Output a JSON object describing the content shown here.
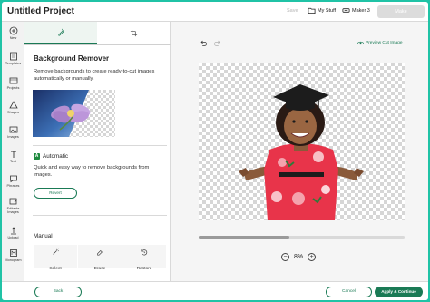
{
  "app": {
    "title": "Untitled Project"
  },
  "topbar": {
    "save_label": "Save",
    "my_stuff_label": "My Stuff",
    "machine_label": "Maker 3",
    "make_label": "Make"
  },
  "rail": {
    "items": [
      {
        "label": "New",
        "icon": "plus-circle-icon"
      },
      {
        "label": "Templates",
        "icon": "templates-icon"
      },
      {
        "label": "Projects",
        "icon": "projects-icon"
      },
      {
        "label": "Shapes",
        "icon": "shapes-icon"
      },
      {
        "label": "Images",
        "icon": "images-icon"
      },
      {
        "label": "Text",
        "icon": "text-icon"
      },
      {
        "label": "Phrases",
        "icon": "phrases-icon"
      },
      {
        "label": "Editable Images",
        "icon": "editable-images-icon"
      },
      {
        "label": "Upload",
        "icon": "upload-icon"
      },
      {
        "label": "Monogram",
        "icon": "monogram-icon"
      }
    ]
  },
  "panel": {
    "heading": "Background Remover",
    "description": "Remove backgrounds to create ready-to-cut images automatically or manually.",
    "automatic": {
      "badge": "A",
      "label": "Automatic",
      "description": "Quick and easy way to remove backgrounds from images.",
      "revert_label": "Revert"
    },
    "manual": {
      "label": "Manual",
      "tools": [
        "Select",
        "Erase",
        "Restore"
      ]
    }
  },
  "canvas": {
    "preview_label": "Preview Cut Image",
    "zoom_value": "8%",
    "zoom_minus": "−",
    "zoom_plus": "+"
  },
  "bottom": {
    "back_label": "Back",
    "cancel_label": "Cancel",
    "apply_label": "Apply & Continue"
  },
  "colors": {
    "accent": "#1a7a55",
    "frame": "#20c3a6",
    "dress": "#e8344a"
  }
}
